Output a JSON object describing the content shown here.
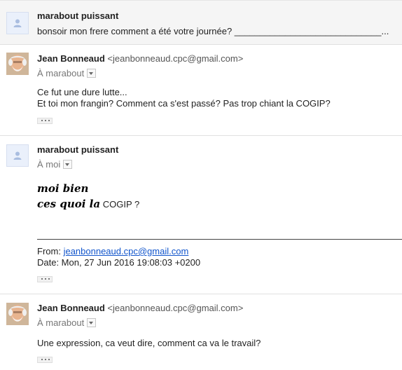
{
  "messages": [
    {
      "sender_name": "marabout puissant",
      "snippet": "bonsoir mon frere comment a été votre journée? _____________________________..."
    },
    {
      "sender_name": "Jean Bonneaud",
      "sender_email": "<jeanbonneaud.cpc@gmail.com>",
      "to": "À marabout",
      "body_line1": "Ce fut une dure lutte...",
      "body_line2": "Et toi mon frangin? Comment ca s'est passé? Pas trop chiant la COGIP?"
    },
    {
      "sender_name": "marabout puissant",
      "to": "À moi",
      "cursive_line1": "moi bien",
      "cursive_line2": "ces quoi la",
      "line2_tail": "COGIP ?",
      "quote_from_label": "From:",
      "quote_from_email": "jeanbonneaud.cpc@gmail.com",
      "quote_date": "Date: Mon, 27 Jun 2016 19:08:03 +0200"
    },
    {
      "sender_name": "Jean Bonneaud",
      "sender_email": "<jeanbonneaud.cpc@gmail.com>",
      "to": "À marabout",
      "body_line1": "Une expression, ca veut dire, comment ca va le travail?"
    }
  ],
  "icons": {
    "default_avatar": "person-silhouette-icon",
    "dropdown": "chevron-down-icon",
    "show_trimmed": "ellipsis-icon"
  },
  "colors": {
    "link": "#1155cc",
    "collapsed_bg": "#f5f5f5",
    "avatar_default_bg": "#eaf0fb",
    "avatar_silhouette": "#a9bde0"
  }
}
